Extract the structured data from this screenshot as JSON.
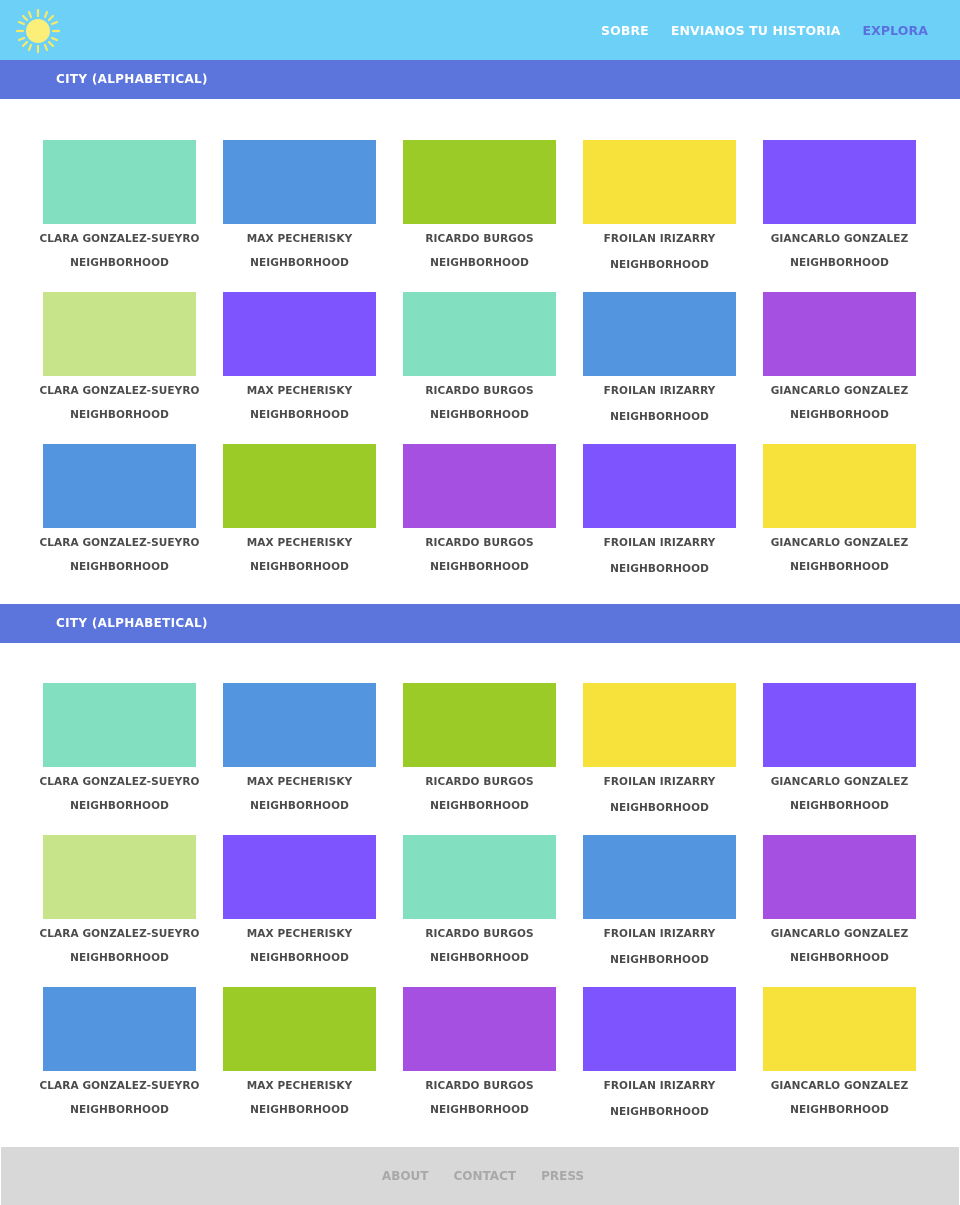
{
  "header": {
    "logo_icon": "sun-icon",
    "nav": [
      {
        "label": "SOBRE",
        "active": false
      },
      {
        "label": "ENVIANOS TU HISTORIA",
        "active": false
      },
      {
        "label": "EXPLORA",
        "active": true
      }
    ]
  },
  "colors": {
    "header_bg": "#6cd0f7",
    "section_bg": "#5b75dc",
    "active_nav": "#5b70e0",
    "footer_bg": "#d8d8d8",
    "mint": "#82dfc0",
    "blue": "#5495e0",
    "green": "#9bcb27",
    "yellow": "#f7e23b",
    "violet": "#7d54fd",
    "lightgreen": "#c7e48a",
    "purple": "#a550e0"
  },
  "sections": [
    {
      "title": "CITY (ALPHABETICAL)",
      "rows": [
        [
          {
            "color": "#82dfc0",
            "name": "CLARA GONZALEZ-SUEYRO",
            "neighborhood": "NEIGHBORHOOD"
          },
          {
            "color": "#5495e0",
            "name": "MAX PECHERISKY",
            "neighborhood": "NEIGHBORHOOD"
          },
          {
            "color": "#9bcb27",
            "name": "RICARDO BURGOS",
            "neighborhood": "NEIGHBORHOOD"
          },
          {
            "color": "#f7e23b",
            "name": "FROILAN IRIZARRY",
            "neighborhood": "NEIGHBORHOOD"
          },
          {
            "color": "#7d54fd",
            "name": "GIANCARLO GONZALEZ",
            "neighborhood": "NEIGHBORHOOD"
          }
        ],
        [
          {
            "color": "#c7e48a",
            "name": "CLARA GONZALEZ-SUEYRO",
            "neighborhood": "NEIGHBORHOOD"
          },
          {
            "color": "#7d54fd",
            "name": "MAX PECHERISKY",
            "neighborhood": "NEIGHBORHOOD"
          },
          {
            "color": "#82dfc0",
            "name": "RICARDO BURGOS",
            "neighborhood": "NEIGHBORHOOD"
          },
          {
            "color": "#5495e0",
            "name": "FROILAN IRIZARRY",
            "neighborhood": "NEIGHBORHOOD"
          },
          {
            "color": "#a550e0",
            "name": "GIANCARLO GONZALEZ",
            "neighborhood": "NEIGHBORHOOD"
          }
        ],
        [
          {
            "color": "#5495e0",
            "name": "CLARA GONZALEZ-SUEYRO",
            "neighborhood": "NEIGHBORHOOD"
          },
          {
            "color": "#9bcb27",
            "name": "MAX PECHERISKY",
            "neighborhood": "NEIGHBORHOOD"
          },
          {
            "color": "#a550e0",
            "name": "RICARDO BURGOS",
            "neighborhood": "NEIGHBORHOOD"
          },
          {
            "color": "#7d54fd",
            "name": "FROILAN IRIZARRY",
            "neighborhood": "NEIGHBORHOOD"
          },
          {
            "color": "#f7e23b",
            "name": "GIANCARLO GONZALEZ",
            "neighborhood": "NEIGHBORHOOD"
          }
        ]
      ]
    },
    {
      "title": "CITY (ALPHABETICAL)",
      "rows": [
        [
          {
            "color": "#82dfc0",
            "name": "CLARA GONZALEZ-SUEYRO",
            "neighborhood": "NEIGHBORHOOD"
          },
          {
            "color": "#5495e0",
            "name": "MAX PECHERISKY",
            "neighborhood": "NEIGHBORHOOD"
          },
          {
            "color": "#9bcb27",
            "name": "RICARDO BURGOS",
            "neighborhood": "NEIGHBORHOOD"
          },
          {
            "color": "#f7e23b",
            "name": "FROILAN IRIZARRY",
            "neighborhood": "NEIGHBORHOOD"
          },
          {
            "color": "#7d54fd",
            "name": "GIANCARLO GONZALEZ",
            "neighborhood": "NEIGHBORHOOD"
          }
        ],
        [
          {
            "color": "#c7e48a",
            "name": "CLARA GONZALEZ-SUEYRO",
            "neighborhood": "NEIGHBORHOOD"
          },
          {
            "color": "#7d54fd",
            "name": "MAX PECHERISKY",
            "neighborhood": "NEIGHBORHOOD"
          },
          {
            "color": "#82dfc0",
            "name": "RICARDO BURGOS",
            "neighborhood": "NEIGHBORHOOD"
          },
          {
            "color": "#5495e0",
            "name": "FROILAN IRIZARRY",
            "neighborhood": "NEIGHBORHOOD"
          },
          {
            "color": "#a550e0",
            "name": "GIANCARLO GONZALEZ",
            "neighborhood": "NEIGHBORHOOD"
          }
        ],
        [
          {
            "color": "#5495e0",
            "name": "CLARA GONZALEZ-SUEYRO",
            "neighborhood": "NEIGHBORHOOD"
          },
          {
            "color": "#9bcb27",
            "name": "MAX PECHERISKY",
            "neighborhood": "NEIGHBORHOOD"
          },
          {
            "color": "#a550e0",
            "name": "RICARDO BURGOS",
            "neighborhood": "NEIGHBORHOOD"
          },
          {
            "color": "#7d54fd",
            "name": "FROILAN IRIZARRY",
            "neighborhood": "NEIGHBORHOOD"
          },
          {
            "color": "#f7e23b",
            "name": "GIANCARLO GONZALEZ",
            "neighborhood": "NEIGHBORHOOD"
          }
        ]
      ]
    }
  ],
  "footer": {
    "links": [
      "ABOUT",
      "CONTACT",
      "PRESS"
    ]
  }
}
